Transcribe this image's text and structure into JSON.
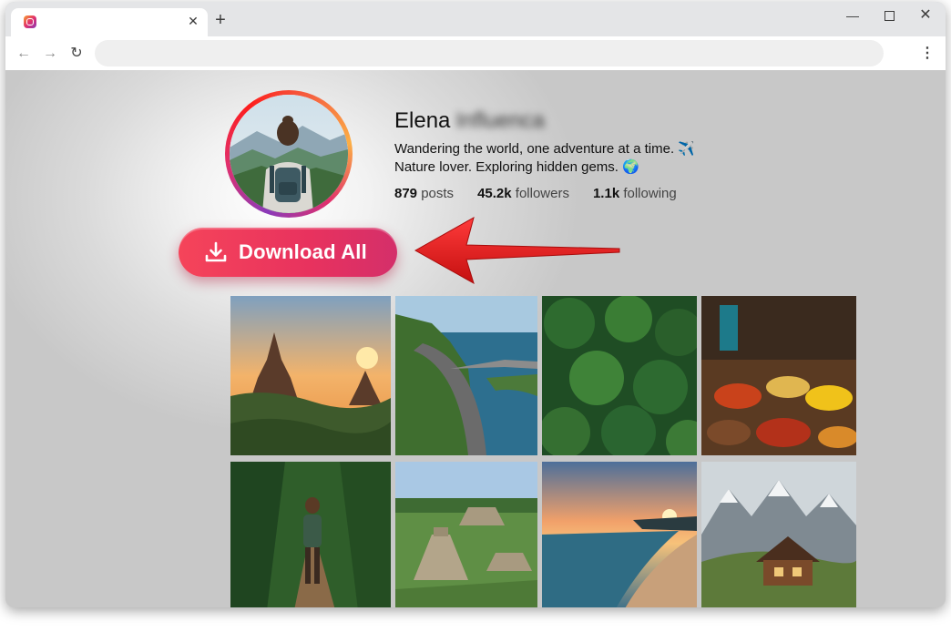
{
  "browser": {
    "tab": {
      "favicon": "instagram-icon",
      "title": "",
      "close_icon": "close-icon"
    },
    "new_tab_icon": "plus-icon",
    "window_controls": [
      "minimize-icon",
      "maximize-icon",
      "close-icon"
    ],
    "toolbar": {
      "back_icon": "arrow-left-icon",
      "forward_icon": "arrow-right-icon",
      "reload_icon": "reload-icon",
      "address": "",
      "menu_icon": "kebab-menu-icon"
    }
  },
  "profile": {
    "name": "Elena",
    "name_blurred": "Influenca",
    "bio_line_1": "Wandering the world, one adventure at a time. ✈️",
    "bio_line_2": "Nature lover. Exploring hidden gems. 🌍",
    "stats": {
      "posts_count": "879",
      "posts_label": "posts",
      "followers_count": "45.2k",
      "followers_label": "followers",
      "following_count": "1.1k",
      "following_label": "following"
    }
  },
  "download_button": {
    "label": "Download All",
    "icon": "download-icon"
  },
  "colors": {
    "button_gradient_start": "#f5445a",
    "button_gradient_end": "#d42f6a",
    "arrow": "#e01818",
    "instagram_ring": [
      "#8a3ab9",
      "#e1306c",
      "#fd1d1d",
      "#fcaf45"
    ]
  },
  "photos": [
    {
      "subject": "temple-sunset"
    },
    {
      "subject": "coastal-highway"
    },
    {
      "subject": "forest-aerial"
    },
    {
      "subject": "spice-market"
    },
    {
      "subject": "jungle-hiker"
    },
    {
      "subject": "mayan-pyramid"
    },
    {
      "subject": "beach-sunset"
    },
    {
      "subject": "mountain-cabin"
    }
  ]
}
